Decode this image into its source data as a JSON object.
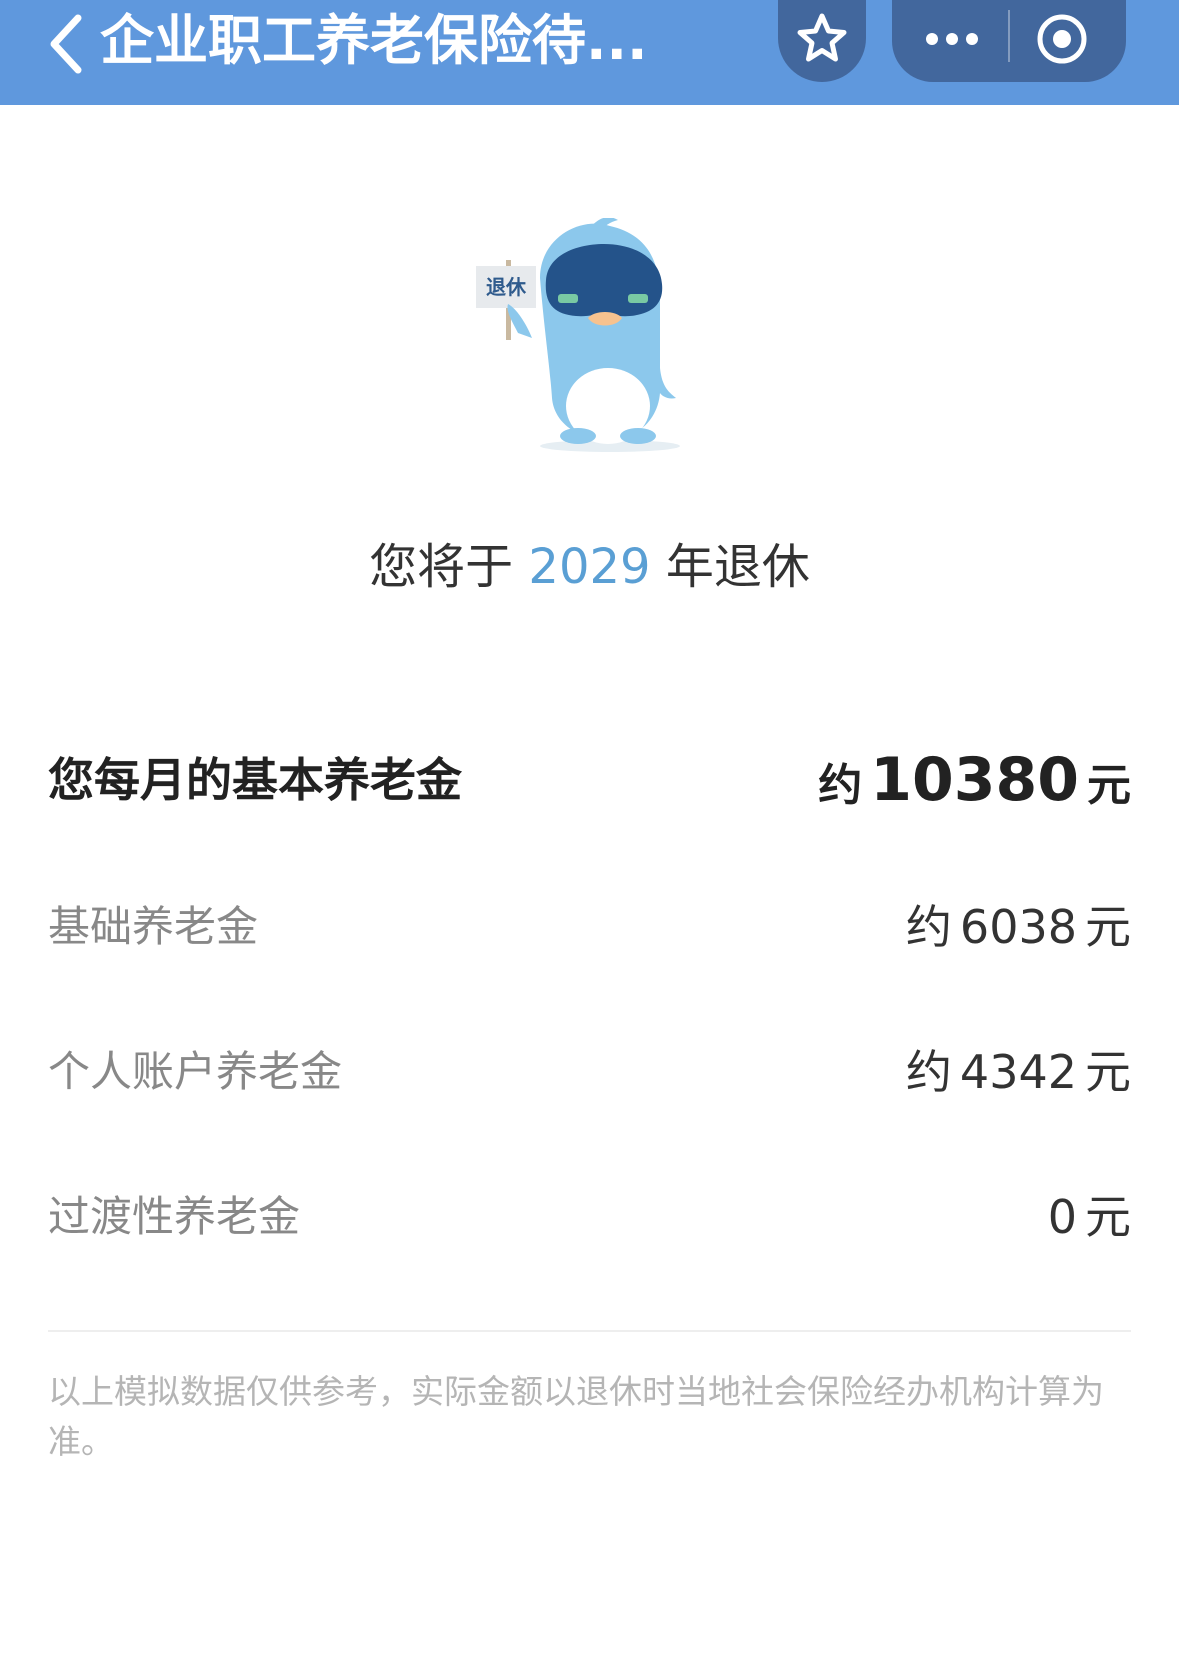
{
  "header": {
    "title": "企业职工养老保险待...",
    "back_icon": "chevron-left-icon",
    "favorite_icon": "star-icon",
    "more_icon": "ellipsis-icon",
    "close_icon": "target-circle-icon",
    "bar_color": "#5f98dd",
    "button_color": "#42679d"
  },
  "mascot": {
    "sign_text": "退休",
    "body_color": "#8cc8ec"
  },
  "retire": {
    "prefix": "您将于",
    "year": "2029",
    "suffix": "年退休",
    "year_color": "#5a9fd4"
  },
  "pension": {
    "main": {
      "label": "您每月的基本养老金",
      "prefix": "约",
      "amount": "10380",
      "unit": "元"
    },
    "items": [
      {
        "label": "基础养老金",
        "prefix": "约",
        "amount": "6038",
        "unit": "元"
      },
      {
        "label": "个人账户养老金",
        "prefix": "约",
        "amount": "4342",
        "unit": "元"
      },
      {
        "label": "过渡性养老金",
        "prefix": "",
        "amount": "0",
        "unit": "元"
      }
    ]
  },
  "disclaimer": "以上模拟数据仅供参考，实际金额以退休时当地社会保险经办机构计算为准。"
}
